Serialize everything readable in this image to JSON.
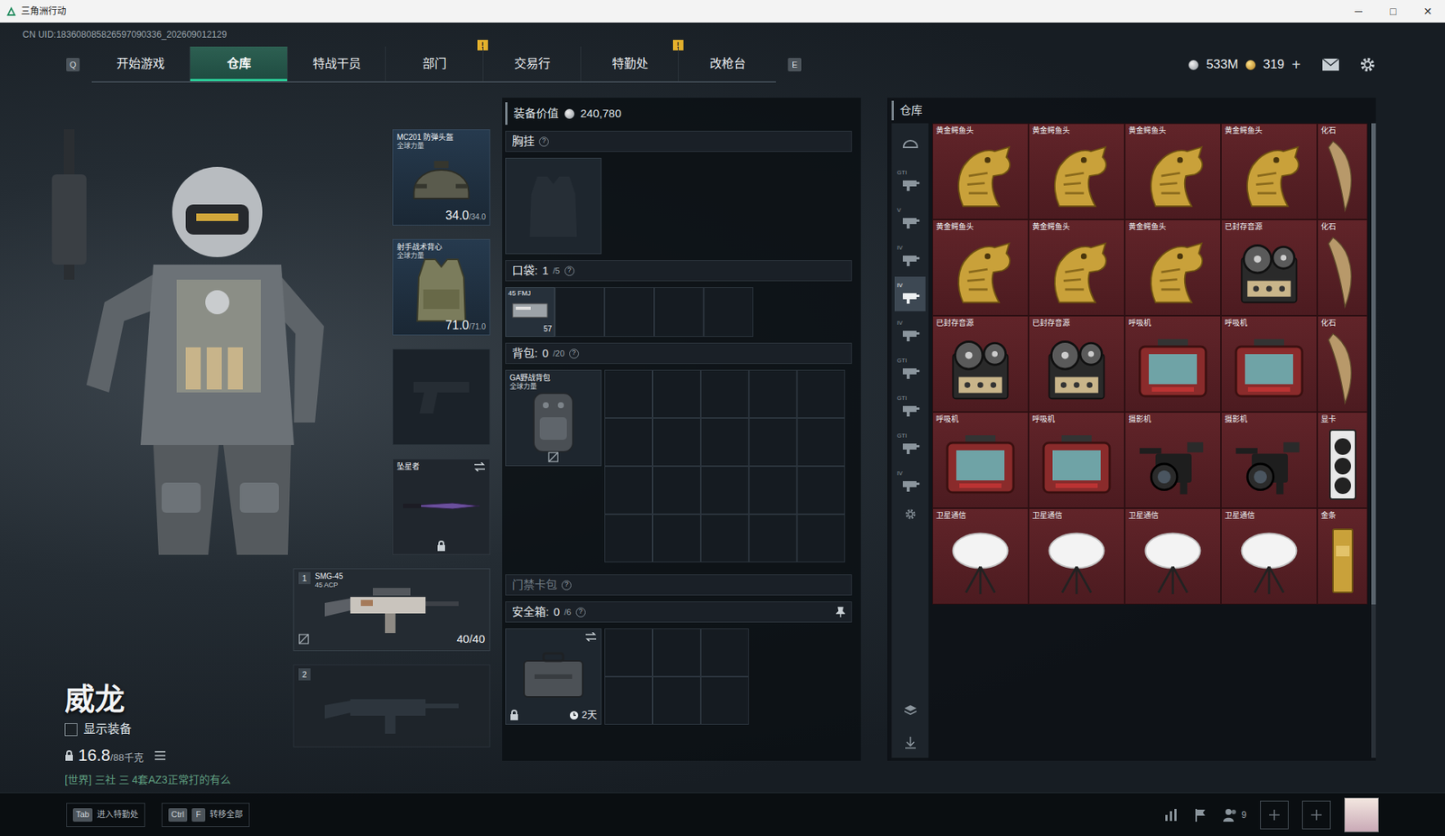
{
  "window": {
    "title": "三角洲行动",
    "controls": [
      "─",
      "□",
      "✕"
    ]
  },
  "uid": "CN UID:183608085826597090336_202609012129",
  "nav": {
    "prev_key": "Q",
    "next_key": "E",
    "alert_text": "!",
    "tabs": [
      {
        "label": "开始游戏",
        "selected": false,
        "alert": false
      },
      {
        "label": "仓库",
        "selected": true,
        "alert": false
      },
      {
        "label": "特战干员",
        "selected": false,
        "alert": false
      },
      {
        "label": "部门",
        "selected": false,
        "alert": true
      },
      {
        "label": "交易行",
        "selected": false,
        "alert": false
      },
      {
        "label": "特勤处",
        "selected": false,
        "alert": true
      },
      {
        "label": "改枪台",
        "selected": false,
        "alert": false
      }
    ]
  },
  "currencies": [
    {
      "kind": "coin",
      "value": "533M"
    },
    {
      "kind": "gold",
      "value": "319",
      "action": "+"
    }
  ],
  "operator": {
    "name": "威龙",
    "show_gear": {
      "label": "显示装备",
      "checked": false
    },
    "weight": "16.8",
    "weight_max": "/88千克",
    "chat": "[世界] 三社 三 4套AZ3正常打的有么"
  },
  "gear": [
    {
      "kind": "helmet",
      "empty": false,
      "name": "MC201 防弹头盔",
      "sub": "全球力量",
      "durability": "34.0",
      "max": "/34.0"
    },
    {
      "kind": "armor",
      "empty": false,
      "name": "射手战术背心",
      "sub": "全球力量",
      "durability": "71.0",
      "max": "/71.0"
    },
    {
      "kind": "pistol",
      "empty": true
    },
    {
      "kind": "melee",
      "empty": false,
      "name": "坠星者",
      "locked": true
    }
  ],
  "weapons": [
    {
      "slot": "1",
      "empty": false,
      "name": "SMG-45",
      "sub": "45 ACP",
      "ammo": "40/40"
    },
    {
      "slot": "2",
      "empty": true
    }
  ],
  "loadout": {
    "value_label": "装备价值",
    "value": "240,780",
    "help": "?",
    "chest": {
      "label": "胸挂",
      "empty": true
    },
    "pockets": {
      "label": "口袋:",
      "used": "1",
      "cap": "/5",
      "slots": [
        {
          "empty": false,
          "name": "45 FMJ",
          "count": "57"
        },
        {
          "empty": true
        },
        {
          "empty": true
        },
        {
          "empty": true
        },
        {
          "empty": true
        }
      ]
    },
    "backpack": {
      "label": "背包:",
      "used": "0",
      "cap": "/20",
      "item": {
        "name": "GA野战背包",
        "sub": "全球力量"
      },
      "cells": 20
    },
    "keycard": {
      "label": "门禁卡包",
      "enabled": false
    },
    "safe": {
      "label": "安全箱:",
      "used": "0",
      "cap": "/6",
      "timer": "2天",
      "locked": true,
      "cells": 6
    }
  },
  "warehouse": {
    "title": "仓库",
    "categories": [
      {
        "selected": false
      },
      {
        "label": "GTI",
        "selected": false
      },
      {
        "label": "V",
        "selected": false
      },
      {
        "label": "IV",
        "selected": false
      },
      {
        "label": "IV",
        "selected": true
      },
      {
        "label": "IV",
        "selected": false
      },
      {
        "label": "GTI",
        "selected": false
      },
      {
        "label": "GTI",
        "selected": false
      },
      {
        "label": "GTI",
        "selected": false
      },
      {
        "label": "IV",
        "selected": false
      }
    ],
    "items": [
      {
        "label": "黄金鳄鱼头",
        "kind": "croc"
      },
      {
        "label": "黄金鳄鱼头",
        "kind": "croc"
      },
      {
        "label": "黄金鳄鱼头",
        "kind": "croc"
      },
      {
        "label": "黄金鳄鱼头",
        "kind": "croc"
      },
      {
        "label": "化石",
        "kind": "fossil"
      },
      {
        "label": "黄金鳄鱼头",
        "kind": "croc"
      },
      {
        "label": "黄金鳄鱼头",
        "kind": "croc"
      },
      {
        "label": "黄金鳄鱼头",
        "kind": "croc"
      },
      {
        "label": "已封存音源",
        "kind": "tape"
      },
      {
        "label": "化石",
        "kind": "fossil"
      },
      {
        "label": "已封存音源",
        "kind": "tape"
      },
      {
        "label": "已封存音源",
        "kind": "tape"
      },
      {
        "label": "呼吸机",
        "kind": "vent"
      },
      {
        "label": "呼吸机",
        "kind": "vent"
      },
      {
        "label": "化石",
        "kind": "fossil"
      },
      {
        "label": "呼吸机",
        "kind": "vent"
      },
      {
        "label": "呼吸机",
        "kind": "vent"
      },
      {
        "label": "摄影机",
        "kind": "camera"
      },
      {
        "label": "摄影机",
        "kind": "camera"
      },
      {
        "label": "显卡",
        "kind": "gpu"
      },
      {
        "label": "卫星通信",
        "kind": "dish"
      },
      {
        "label": "卫星通信",
        "kind": "dish"
      },
      {
        "label": "卫星通信",
        "kind": "dish"
      },
      {
        "label": "卫星通信",
        "kind": "dish"
      },
      {
        "label": "金条",
        "kind": "gold"
      }
    ]
  },
  "bottom": {
    "hints": [
      {
        "keys": [
          "Tab"
        ],
        "label": "进入特勤处"
      },
      {
        "keys": [
          "Ctrl",
          "F"
        ],
        "label": "转移全部"
      }
    ],
    "friends": "9"
  }
}
